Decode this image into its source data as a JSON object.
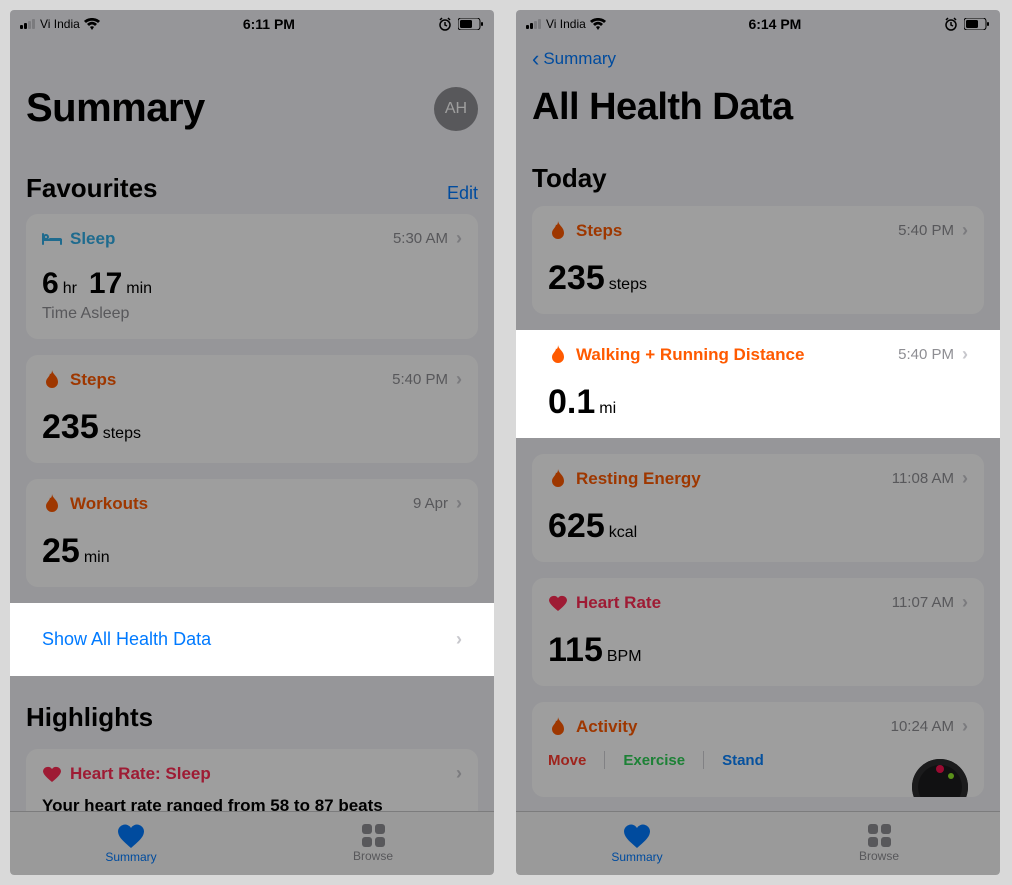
{
  "left": {
    "status": {
      "carrier": "Vi India",
      "time": "6:11 PM"
    },
    "title": "Summary",
    "avatar": "AH",
    "favourites": {
      "heading": "Favourites",
      "edit": "Edit",
      "sleep": {
        "label": "Sleep",
        "time": "5:30 AM",
        "hours": "6",
        "hr_unit": "hr",
        "minutes": "17",
        "min_unit": "min",
        "sub": "Time Asleep"
      },
      "steps": {
        "label": "Steps",
        "time": "5:40 PM",
        "value": "235",
        "unit": "steps"
      },
      "workouts": {
        "label": "Workouts",
        "time": "9 Apr",
        "value": "25",
        "unit": "min"
      }
    },
    "show_all": "Show All Health Data",
    "highlights": {
      "heading": "Highlights",
      "card_title": "Heart Rate: Sleep",
      "snippet": "Your heart rate ranged from 58 to 87 beats"
    },
    "tabs": {
      "summary": "Summary",
      "browse": "Browse"
    }
  },
  "right": {
    "status": {
      "carrier": "Vi India",
      "time": "6:14 PM"
    },
    "back": "Summary",
    "title": "All Health Data",
    "today": "Today",
    "steps": {
      "label": "Steps",
      "time": "5:40 PM",
      "value": "235",
      "unit": "steps"
    },
    "distance": {
      "label": "Walking + Running Distance",
      "time": "5:40 PM",
      "value": "0.1",
      "unit": "mi"
    },
    "resting": {
      "label": "Resting Energy",
      "time": "11:08 AM",
      "value": "625",
      "unit": "kcal"
    },
    "hr": {
      "label": "Heart Rate",
      "time": "11:07 AM",
      "value": "115",
      "unit": "BPM"
    },
    "activity": {
      "label": "Activity",
      "time": "10:24 AM",
      "move": "Move",
      "exercise": "Exercise",
      "stand": "Stand"
    },
    "tabs": {
      "summary": "Summary",
      "browse": "Browse"
    }
  }
}
